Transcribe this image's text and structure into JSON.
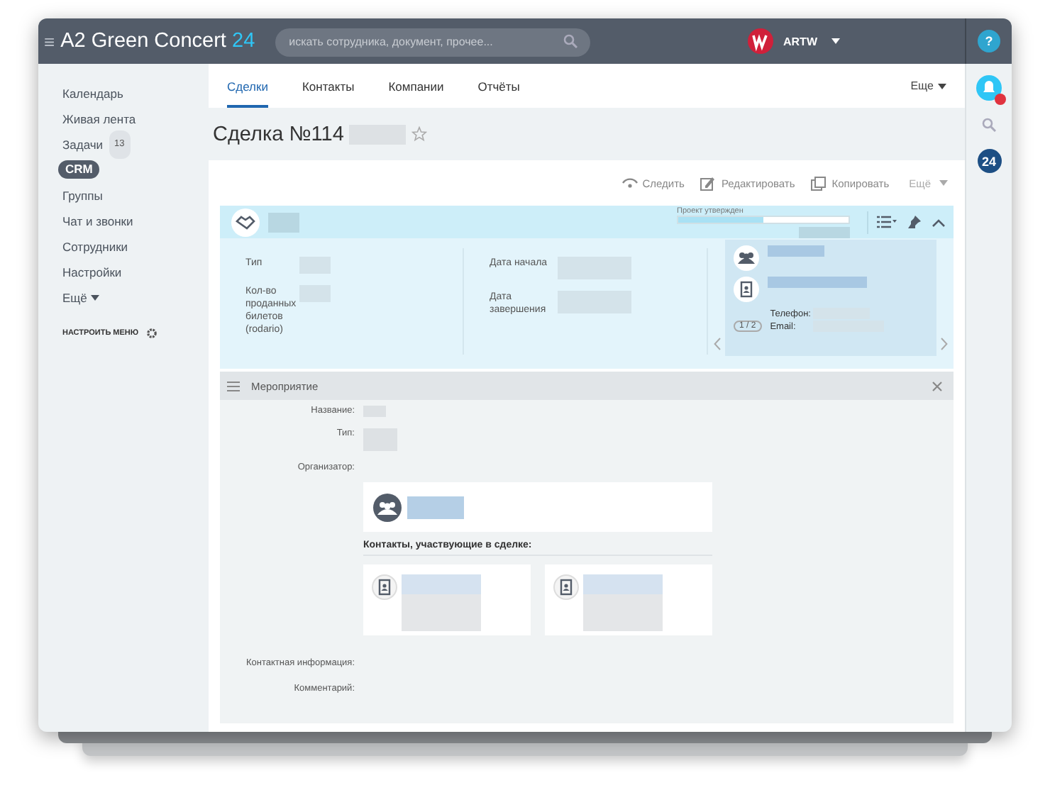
{
  "header": {
    "menu_glyph": "≡",
    "title": "A2 Green Concert",
    "title_suffix": "24",
    "search_placeholder": "искать сотрудника, документ, прочее...",
    "user": "ARTW",
    "help": "?"
  },
  "sidebar": {
    "items": [
      {
        "label": "Календарь",
        "selected": false
      },
      {
        "label": "Живая лента",
        "selected": false
      },
      {
        "label": "Задачи",
        "selected": false,
        "badge": "13"
      },
      {
        "label": "CRM",
        "selected": true
      },
      {
        "label": "Группы",
        "selected": false
      },
      {
        "label": "Чат и звонки",
        "selected": false
      },
      {
        "label": "Сотрудники",
        "selected": false
      },
      {
        "label": "Настройки",
        "selected": false
      }
    ],
    "more": "Ещё",
    "configure": "НАСТРОИТЬ МЕНЮ"
  },
  "tabs": [
    {
      "label": "Сделки",
      "selected": true
    },
    {
      "label": "Контакты",
      "selected": false
    },
    {
      "label": "Компании",
      "selected": false
    },
    {
      "label": "Отчёты",
      "selected": false
    }
  ],
  "tabs_more": "Еще",
  "deal_title": "Сделка №114",
  "toolbar": [
    {
      "label": "Следить",
      "kind": "follow"
    },
    {
      "label": "Редактировать",
      "kind": "edit"
    },
    {
      "label": "Копировать",
      "kind": "copy"
    }
  ],
  "toolbar_more": "Ещё",
  "stage": {
    "label": "Проект утвержден",
    "level": 0.5
  },
  "summary": {
    "column_1": [
      {
        "label": "Тип"
      },
      {
        "label": "Кол-во проданных билетов (rodario)"
      }
    ],
    "column_2": [
      {
        "label": "Дата начала"
      },
      {
        "label": "Дата завершения"
      }
    ],
    "contact": {
      "phone_label": "Телефон:",
      "email_label": "Email:",
      "pager": "1 / 2"
    }
  },
  "section": {
    "title": "Мероприятие",
    "fields": [
      {
        "label": "Название:"
      },
      {
        "label": "Тип:"
      },
      {
        "label": "Организатор:"
      }
    ],
    "contacts_heading": "Контакты, участвующие в сделке:",
    "bottom_fields": [
      {
        "label": "Контактная информация:"
      },
      {
        "label": "Комментарий:"
      }
    ]
  },
  "right_panel": {
    "logo": "24"
  }
}
